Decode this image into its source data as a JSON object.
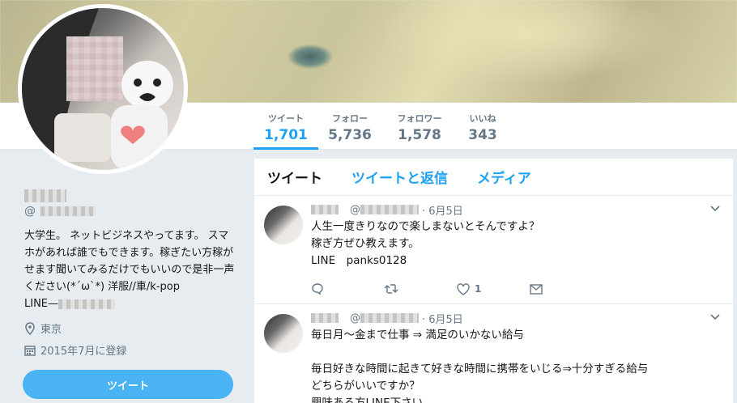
{
  "profile": {
    "bio": "大学生。 ネットビジネスやってます。 スマホがあれば誰でもできます。稼ぎたい方稼がせます聞いてみるだけでもいいので是非一声ください(*´ω`*) 洋服//車/k-pop",
    "line_prefix": "LINE—",
    "handle_at": "@",
    "location": "東京",
    "joined": "2015年7月に登録",
    "tweet_button": "ツイート"
  },
  "stats": [
    {
      "label": "ツイート",
      "value": "1,701"
    },
    {
      "label": "フォロー",
      "value": "5,736"
    },
    {
      "label": "フォロワー",
      "value": "1,578"
    },
    {
      "label": "いいね",
      "value": "343"
    }
  ],
  "tabs": [
    "ツイート",
    "ツイートと返信",
    "メディア"
  ],
  "tweets": [
    {
      "date": "· 6月5日",
      "handle_at": "@",
      "text": "人生一度きりなので楽しまないとそんですよ？\n稼ぎ方ぜひ教えます。\nLINE　panks0128",
      "likes": "1"
    },
    {
      "date": "· 6月5日",
      "handle_at": "@",
      "text": "毎日月〜金まで仕事 ⇒ 満足のいかない給与\n\n毎日好きな時間に起きて好きな時間に携帯をいじる⇒十分すぎる給与\nどちらがいいですか？\n興味ある方LINE下さい"
    }
  ],
  "colors": {
    "accent": "#1da1f2",
    "button": "#4ab3f4",
    "muted": "#657786"
  },
  "icons": [
    "location-icon",
    "calendar-icon",
    "reply-icon",
    "retweet-icon",
    "like-icon",
    "dm-icon",
    "chevron-down-icon"
  ]
}
